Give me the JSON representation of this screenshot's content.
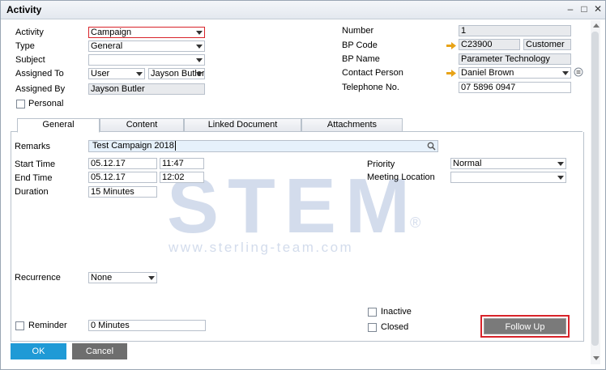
{
  "window": {
    "title": "Activity"
  },
  "header": {
    "activity_label": "Activity",
    "activity_value": "Campaign",
    "type_label": "Type",
    "type_value": "General",
    "subject_label": "Subject",
    "subject_value": "",
    "assigned_to_label": "Assigned To",
    "assigned_to_kind": "User",
    "assigned_to_value": "Jayson Butler",
    "assigned_by_label": "Assigned By",
    "assigned_by_value": "Jayson Butler",
    "personal_label": "Personal",
    "number_label": "Number",
    "number_value": "1",
    "bp_code_label": "BP Code",
    "bp_code_value": "C23900",
    "bp_type_value": "Customer",
    "bp_name_label": "BP Name",
    "bp_name_value": "Parameter Technology",
    "contact_person_label": "Contact Person",
    "contact_person_value": "Daniel Brown",
    "telephone_label": "Telephone No.",
    "telephone_value": "07 5896 0947"
  },
  "tabs": [
    {
      "label": "General",
      "active": true
    },
    {
      "label": "Content",
      "active": false
    },
    {
      "label": "Linked Document",
      "active": false
    },
    {
      "label": "Attachments",
      "active": false
    }
  ],
  "general": {
    "remarks_label": "Remarks",
    "remarks_value": "Test Campaign 2018",
    "start_time_label": "Start Time",
    "start_date": "05.12.17",
    "start_time": "11:47",
    "end_time_label": "End Time",
    "end_date": "05.12.17",
    "end_time": "12:02",
    "duration_label": "Duration",
    "duration_value": "15 Minutes",
    "priority_label": "Priority",
    "priority_value": "Normal",
    "meeting_location_label": "Meeting Location",
    "meeting_location_value": "",
    "recurrence_label": "Recurrence",
    "recurrence_value": "None",
    "reminder_label": "Reminder",
    "reminder_value": "0 Minutes",
    "inactive_label": "Inactive",
    "closed_label": "Closed",
    "follow_up_label": "Follow Up"
  },
  "footer": {
    "ok_label": "OK",
    "cancel_label": "Cancel"
  },
  "watermark": {
    "brand": "STEM",
    "registered": "®",
    "url": "www.sterling-team.com"
  },
  "colors": {
    "accent_blue": "#1f9ad6",
    "highlight_red": "#d8232a",
    "cancel_gray": "#6e6e6e",
    "link_arrow": "#e8a317"
  }
}
